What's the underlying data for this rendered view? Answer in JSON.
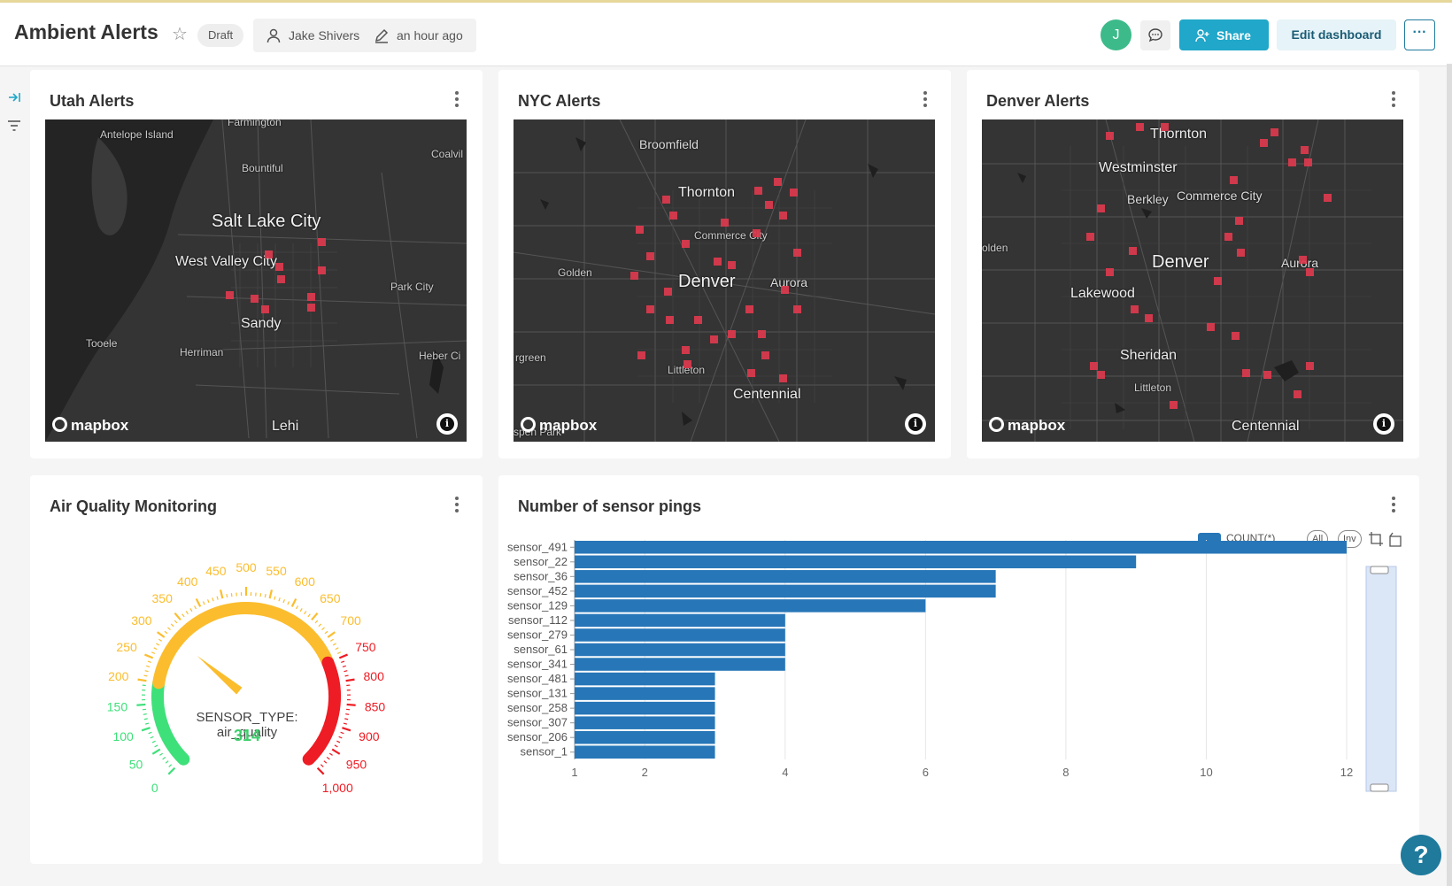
{
  "header": {
    "title": "Ambient Alerts",
    "status": "Draft",
    "owner": "Jake Shivers",
    "modified": "an hour ago",
    "avatar_initial": "J",
    "share_label": "Share",
    "edit_label": "Edit dashboard",
    "more_label": "···"
  },
  "cards": {
    "utah": {
      "title": "Utah Alerts"
    },
    "nyc": {
      "title": "NYC Alerts"
    },
    "denver": {
      "title": "Denver Alerts"
    },
    "air": {
      "title": "Air Quality Monitoring"
    },
    "pings": {
      "title": "Number of sensor pings"
    }
  },
  "maps": {
    "logo": "mapbox",
    "info": "i",
    "utah_labels": [
      "Farmington",
      "Antelope Island",
      "Coalvil",
      "Bountiful",
      "Salt Lake City",
      "West Valley City",
      "Park City",
      "Sandy",
      "Tooele",
      "Herriman",
      "Heber Ci",
      "Lehi"
    ],
    "nyc_labels": [
      "Broomfield",
      "Thornton",
      "Commerce City",
      "Golden",
      "Denver",
      "Aurora",
      "rgreen",
      "Littleton",
      "Centennial",
      "spen Park"
    ],
    "denver_labels": [
      "Thornton",
      "Westminster",
      "Berkley",
      "Commerce City",
      "olden",
      "Denver",
      "Aurora",
      "Lakewood",
      "Sheridan",
      "Littleton",
      "Centennial"
    ]
  },
  "gauge": {
    "label": "SENSOR_TYPE: air_quality",
    "value": 314,
    "min": 0,
    "max": 1000,
    "tick_labels": [
      "0",
      "50",
      "100",
      "150",
      "200",
      "250",
      "300",
      "350",
      "400",
      "450",
      "500",
      "550",
      "600",
      "650",
      "700",
      "750",
      "800",
      "850",
      "900",
      "950",
      "1,000"
    ],
    "colors": {
      "green": "#3ee07a",
      "yellow": "#fbbd2e",
      "red": "#ee1c24"
    }
  },
  "chart_data": {
    "type": "bar",
    "orientation": "horizontal",
    "series_name": "COUNT(*)",
    "categories": [
      "sensor_491",
      "sensor_22",
      "sensor_36",
      "sensor_452",
      "sensor_129",
      "sensor_112",
      "sensor_279",
      "sensor_61",
      "sensor_341",
      "sensor_481",
      "sensor_131",
      "sensor_258",
      "sensor_307",
      "sensor_206",
      "sensor_1"
    ],
    "values": [
      12,
      9,
      7,
      7,
      6,
      4,
      4,
      4,
      4,
      3,
      3,
      3,
      3,
      3,
      3
    ],
    "x_ticks": [
      1,
      2,
      4,
      6,
      8,
      10,
      12
    ],
    "xlim": [
      1,
      12
    ],
    "color": "#2776b8",
    "legend": {
      "all": "All",
      "inv": "Inv"
    }
  }
}
